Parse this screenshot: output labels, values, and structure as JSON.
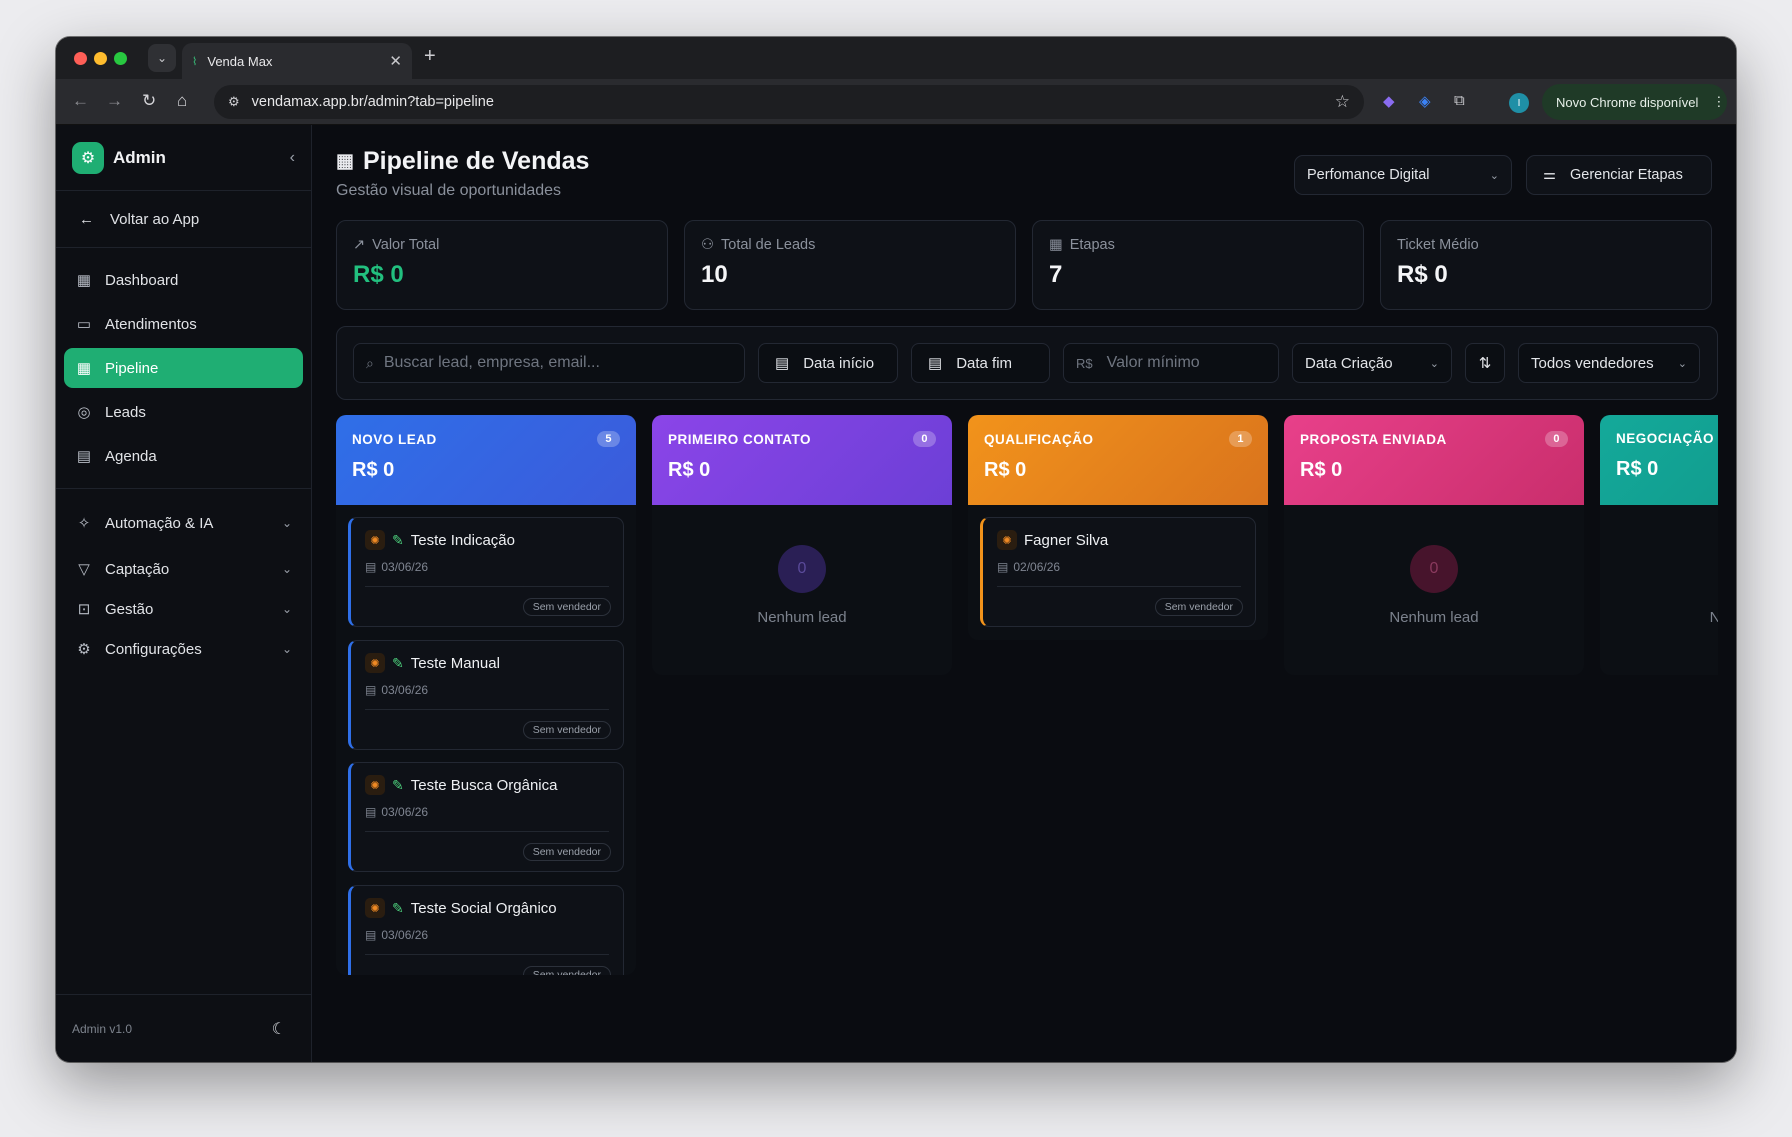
{
  "browser": {
    "tab_title": "Venda Max",
    "url": "vendamax.app.br/admin?tab=pipeline",
    "update_label": "Novo Chrome disponível",
    "profile_initial": "I"
  },
  "sidebar": {
    "brand": "Admin",
    "back_label": "Voltar ao App",
    "items": [
      {
        "label": "Dashboard",
        "icon": "dashboard-icon"
      },
      {
        "label": "Atendimentos",
        "icon": "chat-icon"
      },
      {
        "label": "Pipeline",
        "icon": "pipeline-icon",
        "active": true
      },
      {
        "label": "Leads",
        "icon": "target-icon"
      },
      {
        "label": "Agenda",
        "icon": "calendar-icon"
      }
    ],
    "groups": [
      {
        "label": "Automação & IA",
        "icon": "sparkles-icon"
      },
      {
        "label": "Captação",
        "icon": "funnel-icon"
      },
      {
        "label": "Gestão",
        "icon": "briefcase-icon"
      },
      {
        "label": "Configurações",
        "icon": "gear-icon"
      }
    ],
    "version": "Admin v1.0"
  },
  "header": {
    "title": "Pipeline de Vendas",
    "subtitle": "Gestão visual de oportunidades",
    "pipeline_select": "Perfomance Digital",
    "manage_button": "Gerenciar Etapas"
  },
  "stats": [
    {
      "label": "Valor Total",
      "value": "R$ 0",
      "color": "#22c07f"
    },
    {
      "label": "Total de Leads",
      "value": "10",
      "color": "#f4f5f7"
    },
    {
      "label": "Etapas",
      "value": "7",
      "color": "#f4f5f7"
    },
    {
      "label": "Ticket Médio",
      "value": "R$ 0",
      "color": "#f4f5f7"
    }
  ],
  "filters": {
    "search_placeholder": "Buscar lead, empresa, email...",
    "date_start": "Data início",
    "date_end": "Data fim",
    "currency_prefix": "R$",
    "min_value_placeholder": "Valor mínimo",
    "sort_field": "Data Criação",
    "sellers": "Todos vendedores"
  },
  "columns": [
    {
      "name": "NOVO LEAD",
      "count": "5",
      "value": "R$ 0",
      "color_from": "#2f6fe8",
      "color_to": "#3b5bdb"
    },
    {
      "name": "PRIMEIRO CONTATO",
      "count": "0",
      "value": "R$ 0",
      "color_from": "#8b45e8",
      "color_to": "#6c3fd6"
    },
    {
      "name": "QUALIFICAÇÃO",
      "count": "1",
      "value": "R$ 0",
      "color_from": "#f2931b",
      "color_to": "#d9731d"
    },
    {
      "name": "PROPOSTA ENVIADA",
      "count": "0",
      "value": "R$ 0",
      "color_from": "#e8408a",
      "color_to": "#c92e6c"
    },
    {
      "name": "NEGOCIAÇÃO",
      "value": "R$ 0",
      "color_from": "#14a99a",
      "color_to": "#0f9486"
    }
  ],
  "cards": {
    "novo_lead": [
      {
        "name": "Teste Indicação",
        "date": "03/06/26",
        "seller": "Sem vendedor"
      },
      {
        "name": "Teste Manual",
        "date": "03/06/26",
        "seller": "Sem vendedor"
      },
      {
        "name": "Teste Busca Orgânica",
        "date": "03/06/26",
        "seller": "Sem vendedor"
      },
      {
        "name": "Teste Social Orgânico",
        "date": "03/06/26",
        "seller": "Sem vendedor"
      }
    ],
    "qualificacao": [
      {
        "name": "Fagner Silva",
        "date": "02/06/26",
        "seller": "Sem vendedor"
      }
    ]
  },
  "empty": {
    "count": "0",
    "label": "Nenhum lead",
    "partial_label": "N"
  }
}
